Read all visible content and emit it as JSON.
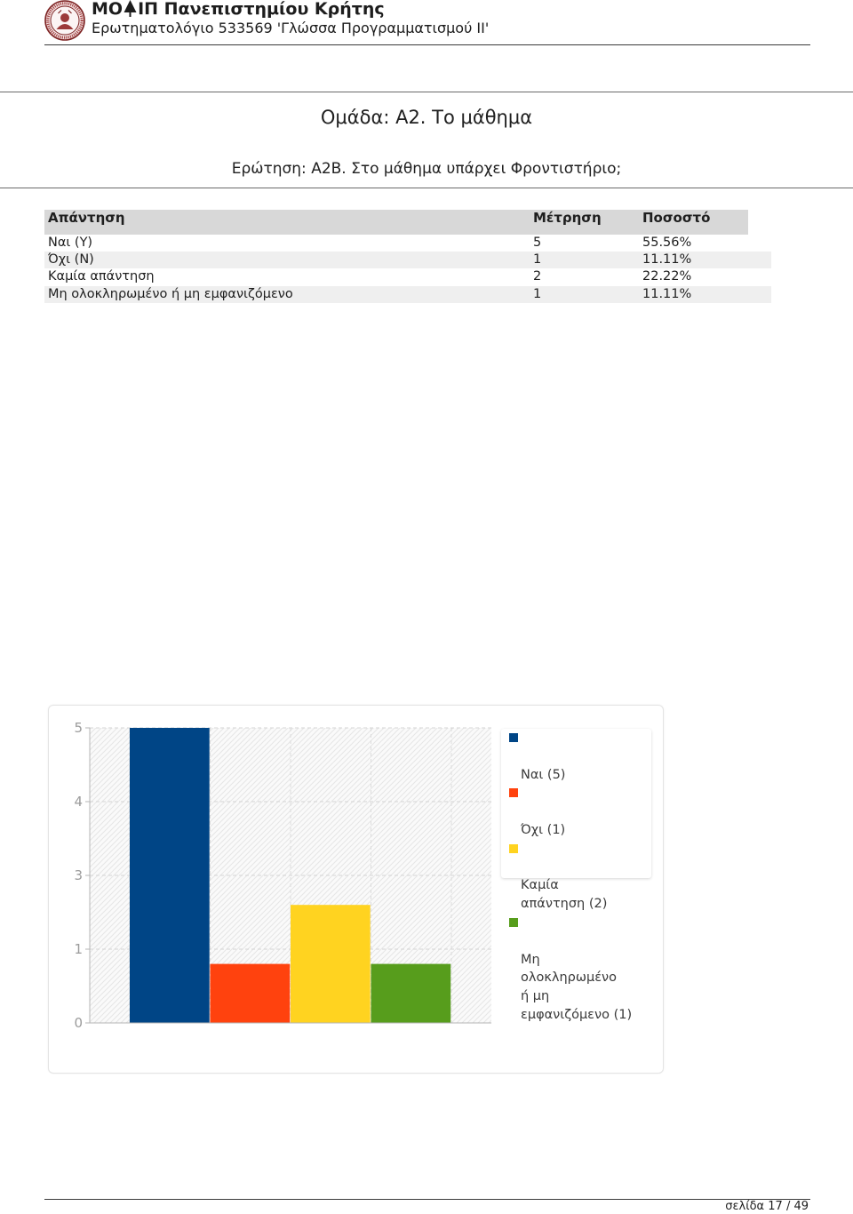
{
  "header": {
    "logo_icon": "university-seal-icon",
    "title_part1": "ΜΟ",
    "title_icon": "delta-tree-icon",
    "title_part2": "ΙΠ Πανεπιστημίου Κρήτης",
    "subtitle": "Ερωτηματολόγιο 533569 'Γλώσσα Προγραμματισμού ΙΙ'"
  },
  "group_title": "Ομάδα: Α2. Το μάθημα",
  "question": "Ερώτηση: Α2Β. Στο μάθημα υπάρχει Φροντιστήριο;",
  "table": {
    "columns": [
      "Απάντηση",
      "Μέτρηση",
      "Ποσοστό"
    ],
    "rows": [
      [
        "Ναι (Y)",
        "5",
        "55.56%"
      ],
      [
        "Όχι (N)",
        "1",
        "11.11%"
      ],
      [
        "Καμία απάντηση",
        "2",
        "22.22%"
      ],
      [
        "Μη ολοκληρωμένο ή μη εμφανιζόμενο",
        "1",
        "11.11%"
      ]
    ]
  },
  "chart_data": {
    "type": "bar",
    "ylim": [
      0,
      5
    ],
    "yticks": [
      0,
      1.25,
      2.5,
      3.75,
      5
    ],
    "ytick_labels": [
      "0",
      "1",
      "3",
      "4",
      "5"
    ],
    "grid": true,
    "legend_position": "right",
    "series": [
      {
        "name": "Ναι (5)",
        "value": 5,
        "color": "#004586"
      },
      {
        "name": "Όχι (1)",
        "value": 1,
        "color": "#ff420e"
      },
      {
        "name": "Καμία\nαπάντηση (2)",
        "value": 2,
        "color": "#ffd320"
      },
      {
        "name": "Μη\nολοκληρωμένο\nή μη\nεμφανιζόμενο (1)",
        "value": 1,
        "color": "#579d1c"
      }
    ]
  },
  "footer": {
    "page": "σελίδα 17 / 49"
  }
}
